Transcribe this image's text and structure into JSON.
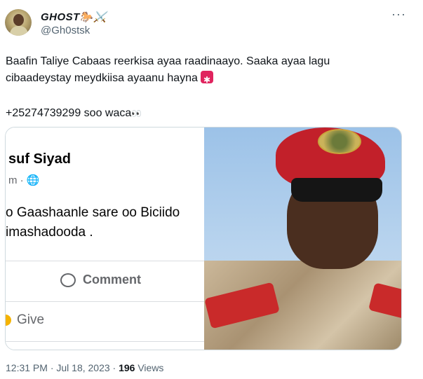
{
  "user": {
    "display_name": "GHOST🐎⚔️",
    "handle": "@Gh0stsk"
  },
  "more_label": "···",
  "tweet": {
    "line1": "Baafin Taliye Cabaas reerkisa ayaa raadinaayo. Saaka ayaa lagu",
    "line2": "cibaadeystay meydkiisa ayaanu hayna",
    "line3": "+25274739299 soo waca",
    "eyes": "👀"
  },
  "media": {
    "fb_name": "suf Siyad",
    "fb_meta": "m · 🌐",
    "fb_post_line1": "o Gaashaanle sare oo Biciido",
    "fb_post_line2": "imashadooda .",
    "comment_label": "Comment",
    "give_label": "Give"
  },
  "footer": {
    "time": "12:31 PM · Jul 18, 2023 · ",
    "views_count": "196",
    "views_label": " Views"
  }
}
